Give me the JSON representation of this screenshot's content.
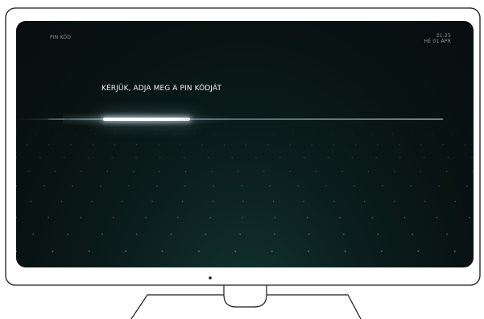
{
  "header": {
    "page_label": "PIN KÓD",
    "time": "21:25",
    "date": "HÉ 01 ÁPR"
  },
  "main": {
    "prompt": "KÉRJÜK, ADJA MEG A PIN KÓDJÁT",
    "pin_progress_fraction": 0.2
  },
  "colors": {
    "screen_background": "#081312",
    "accent": "#ffffff"
  }
}
